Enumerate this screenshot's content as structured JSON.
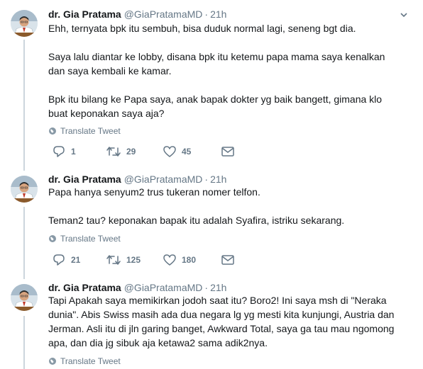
{
  "tweets": [
    {
      "name": "dr. Gia Pratama",
      "handle": "@GiaPratamaMD",
      "separator": "·",
      "time": "21h",
      "text": "Ehh, ternyata bpk itu sembuh, bisa duduk normal lagi,  seneng bgt dia.\n\nSaya lalu diantar ke lobby, disana bpk itu ketemu papa mama saya kenalkan dan saya kembali ke kamar.\n\nBpk itu bilang ke Papa saya, anak bapak dokter yg baik bangett, gimana klo buat keponakan saya aja?",
      "translate": "Translate Tweet",
      "replies": "1",
      "retweets": "29",
      "likes": "45"
    },
    {
      "name": "dr. Gia Pratama",
      "handle": "@GiaPratamaMD",
      "separator": "·",
      "time": "21h",
      "text": "Papa hanya senyum2 trus tukeran nomer telfon.\n\nTeman2 tau?  keponakan bapak itu adalah Syafira, istriku sekarang.",
      "translate": "Translate Tweet",
      "replies": "21",
      "retweets": "125",
      "likes": "180"
    },
    {
      "name": "dr. Gia Pratama",
      "handle": "@GiaPratamaMD",
      "separator": "·",
      "time": "21h",
      "text": "Tapi Apakah saya memikirkan jodoh saat itu? Boro2! Ini saya msh di \"Neraka dunia\". Abis Swiss masih ada dua negara lg yg mesti kita kunjungi, Austria dan Jerman. Asli itu di jln garing banget, Awkward Total, saya ga tau mau ngomong apa, dan dia jg sibuk aja ketawa2 sama adik2nya.",
      "translate": "Translate Tweet"
    }
  ],
  "icons": {
    "reply": "reply-icon",
    "retweet": "retweet-icon",
    "like": "heart-icon",
    "dm": "envelope-icon",
    "globe": "globe-icon",
    "caret": "chevron-down-icon"
  },
  "colors": {
    "text": "#14171a",
    "secondary": "#657786",
    "thread_line": "#ccd6dd"
  }
}
